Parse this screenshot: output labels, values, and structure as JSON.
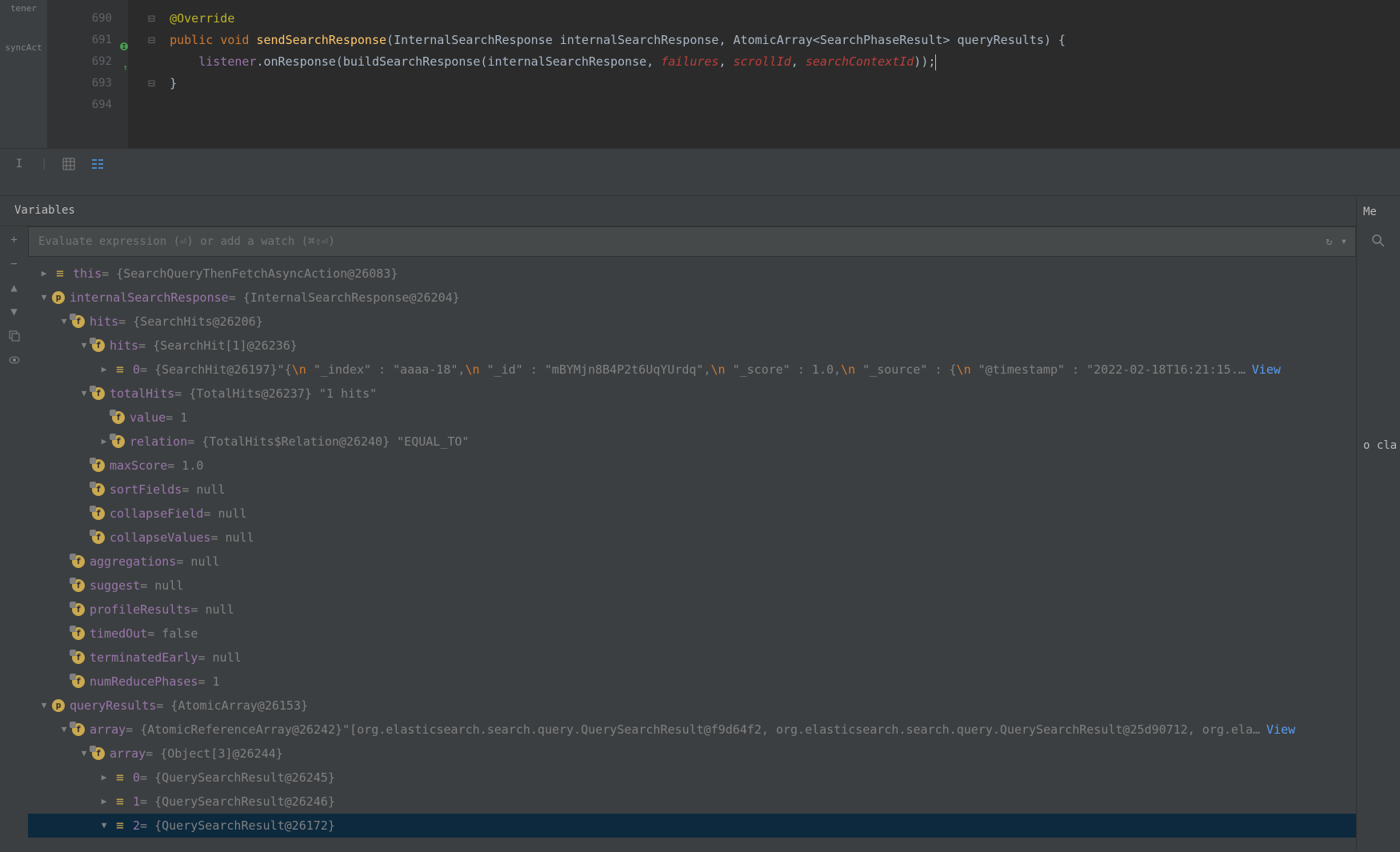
{
  "left_toolbar": {
    "item1": "tener",
    "item2": "syncAct"
  },
  "editor": {
    "lines": {
      "690": {
        "num": "690"
      },
      "691": {
        "num": "691"
      },
      "692": {
        "num": "692"
      },
      "693": {
        "num": "693"
      },
      "694": {
        "num": "694"
      }
    },
    "code": {
      "override": "@Override",
      "public": "public",
      "void": "void",
      "method": "sendSearchResponse",
      "param1_type": "InternalSearchResponse",
      "param1_name": "internalSearchResponse",
      "param2_type": "AtomicArray",
      "param2_generic": "SearchPhaseResult",
      "param2_name": "queryResults",
      "listener": "listener",
      "onResponse": ".onResponse(buildSearchResponse(internalSearchResponse, ",
      "failures": "failures",
      "scrollId": "scrollId",
      "searchContextId": "searchContextId",
      "close_brace": "}"
    }
  },
  "panel": {
    "variables_label": "Variables",
    "watch_placeholder": "Evaluate expression (⏎) or add a watch (⌘⇧⏎)",
    "right_label_me": "Me",
    "right_label_class": "o cla"
  },
  "tree": {
    "this_name": "this",
    "this_val": " = {SearchQueryThenFetchAsyncAction@26083}",
    "isr_name": "internalSearchResponse",
    "isr_val": " = {InternalSearchResponse@26204}",
    "hits_name": "hits",
    "hits_val": " = {SearchHits@26206}",
    "hits2_name": "hits",
    "hits2_val": " = {SearchHit[1]@26236}",
    "hit0_name": "0",
    "hit0_val": " = {SearchHit@26197} ",
    "hit0_preview_1": "\"{",
    "hit0_preview_2": "  \"_index\" : \"aaaa-18\",",
    "hit0_preview_3": "  \"_id\" : \"mBYMjn8B4P2t6UqYUrdq\",",
    "hit0_preview_4": "  \"_score\" : 1.0,",
    "hit0_preview_5": "  \"_source\" : {",
    "hit0_preview_6": "    \"@timestamp\" : \"2022-02-18T16:21:15.",
    "view": "View",
    "totalHits_name": "totalHits",
    "totalHits_val": " = {TotalHits@26237} \"1 hits\"",
    "value_name": "value",
    "value_val": " = 1",
    "relation_name": "relation",
    "relation_val": " = {TotalHits$Relation@26240} \"EQUAL_TO\"",
    "maxScore_name": "maxScore",
    "maxScore_val": " = 1.0",
    "sortFields_name": "sortFields",
    "sortFields_val": " = null",
    "collapseField_name": "collapseField",
    "collapseField_val": " = null",
    "collapseValues_name": "collapseValues",
    "collapseValues_val": " = null",
    "aggregations_name": "aggregations",
    "aggregations_val": " = null",
    "suggest_name": "suggest",
    "suggest_val": " = null",
    "profileResults_name": "profileResults",
    "profileResults_val": " = null",
    "timedOut_name": "timedOut",
    "timedOut_val": " = false",
    "terminatedEarly_name": "terminatedEarly",
    "terminatedEarly_val": " = null",
    "numReducePhases_name": "numReducePhases",
    "numReducePhases_val": " = 1",
    "queryResults_name": "queryResults",
    "queryResults_val": " = {AtomicArray@26153}",
    "array_name": "array",
    "array_val": " = {AtomicReferenceArray@26242} ",
    "array_preview": "\"[org.elasticsearch.search.query.QuerySearchResult@f9d64f2, org.elasticsearch.search.query.QuerySearchResult@25d90712, org.ela",
    "array2_name": "array",
    "array2_val": " = {Object[3]@26244}",
    "arr0_name": "0",
    "arr0_val": " = {QuerySearchResult@26245}",
    "arr1_name": "1",
    "arr1_val": " = {QuerySearchResult@26246}",
    "arr2_name": "2",
    "arr2_val": " = {QuerySearchResult@26172}",
    "newline": "\\n"
  }
}
